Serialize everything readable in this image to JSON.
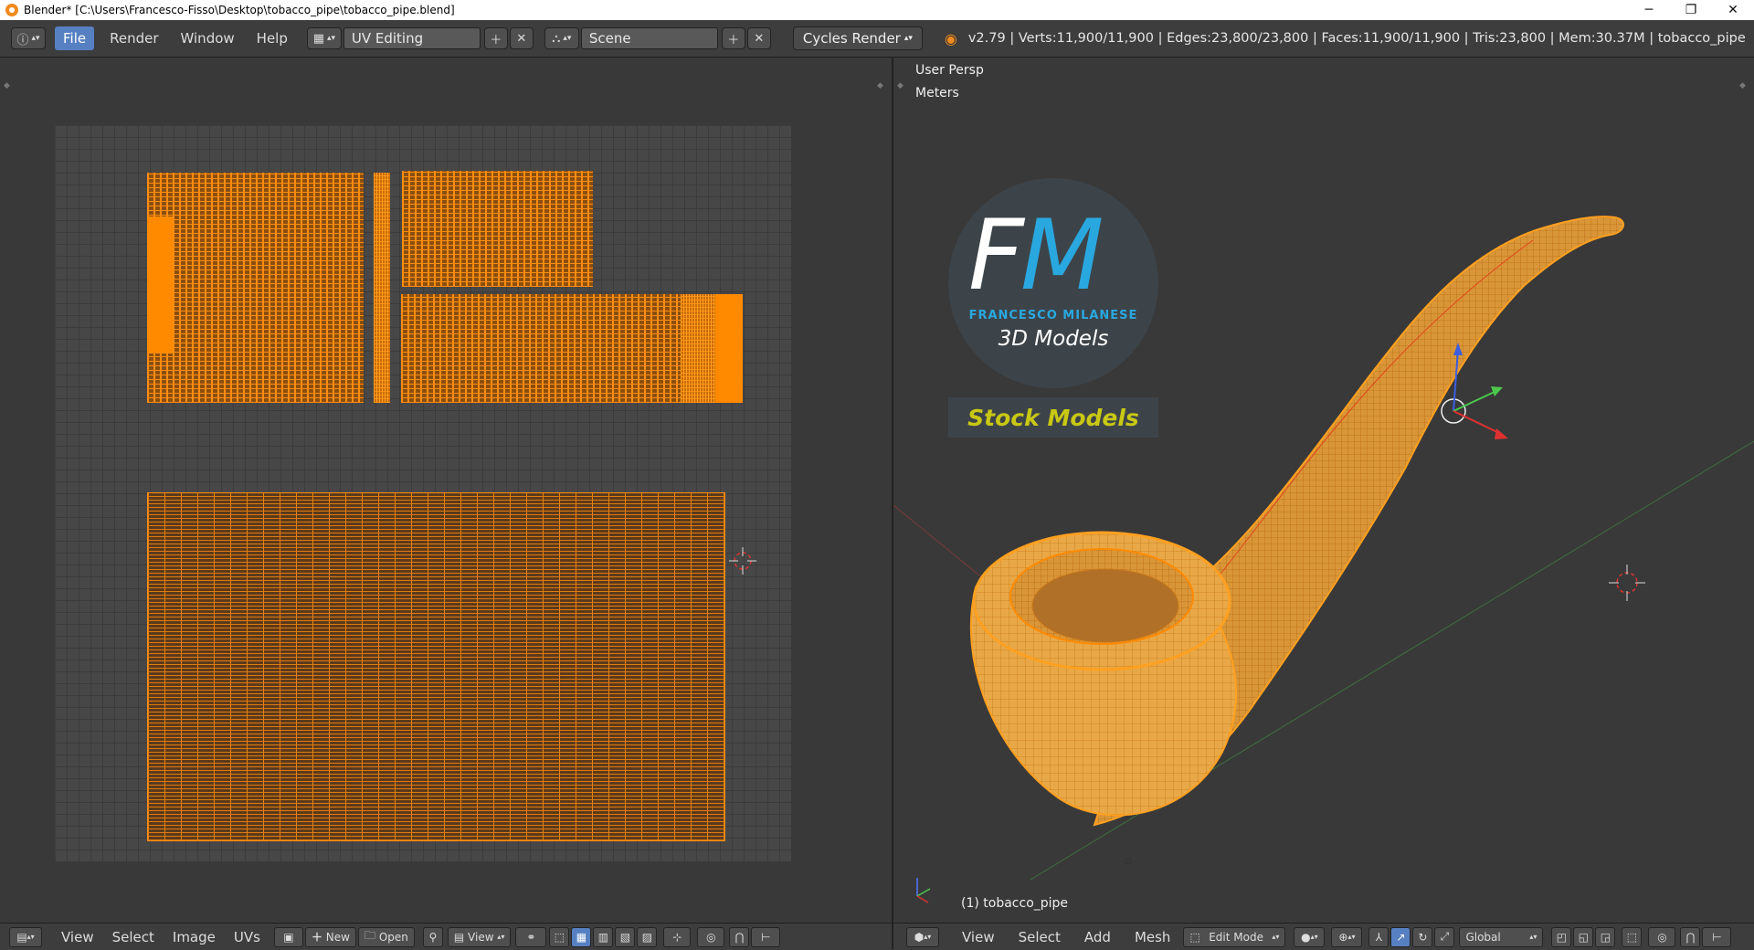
{
  "window": {
    "title": "Blender* [C:\\Users\\Francesco-Fisso\\Desktop\\tobacco_pipe\\tobacco_pipe.blend]",
    "minimize": "─",
    "restore": "❐",
    "close": "✕"
  },
  "info_header": {
    "menus": [
      "File",
      "Render",
      "Window",
      "Help"
    ],
    "active_menu": "File",
    "screen_layout": "UV Editing",
    "scene": "Scene",
    "render_engine": "Cycles Render",
    "stats": "v2.79 | Verts:11,900/11,900 | Edges:23,800/23,800 | Faces:11,900/11,900 | Tris:23,800 | Mem:30.37M | tobacco_pipe"
  },
  "uv_editor": {
    "menus": [
      "View",
      "Select",
      "Image",
      "UVs"
    ],
    "new_label": "New",
    "open_label": "Open",
    "view_label": "View"
  },
  "viewport": {
    "view_name": "User Persp",
    "units": "Meters",
    "object_label": "(1) tobacco_pipe",
    "menus": [
      "View",
      "Select",
      "Add",
      "Mesh"
    ],
    "mode": "Edit Mode",
    "orientation": "Global"
  },
  "logo": {
    "initial_f": "F",
    "initial_m": "M",
    "name": "FRANCESCO MILANESE",
    "subtitle": "3D Models",
    "tagline": "Stock Models"
  },
  "colors": {
    "accent": "#5680c2",
    "uv_orange": "#ff8a00",
    "logo_blue": "#29a8e0",
    "logo_yellow": "#c9c813",
    "background": "#393939"
  },
  "icons": {
    "info": "info-icon",
    "screen": "screen-layout-icon",
    "scene": "scene-icon",
    "blender": "blender-logo-icon",
    "image_editor": "image-editor-icon",
    "pin": "pin-icon",
    "view3d": "3d-view-icon"
  }
}
